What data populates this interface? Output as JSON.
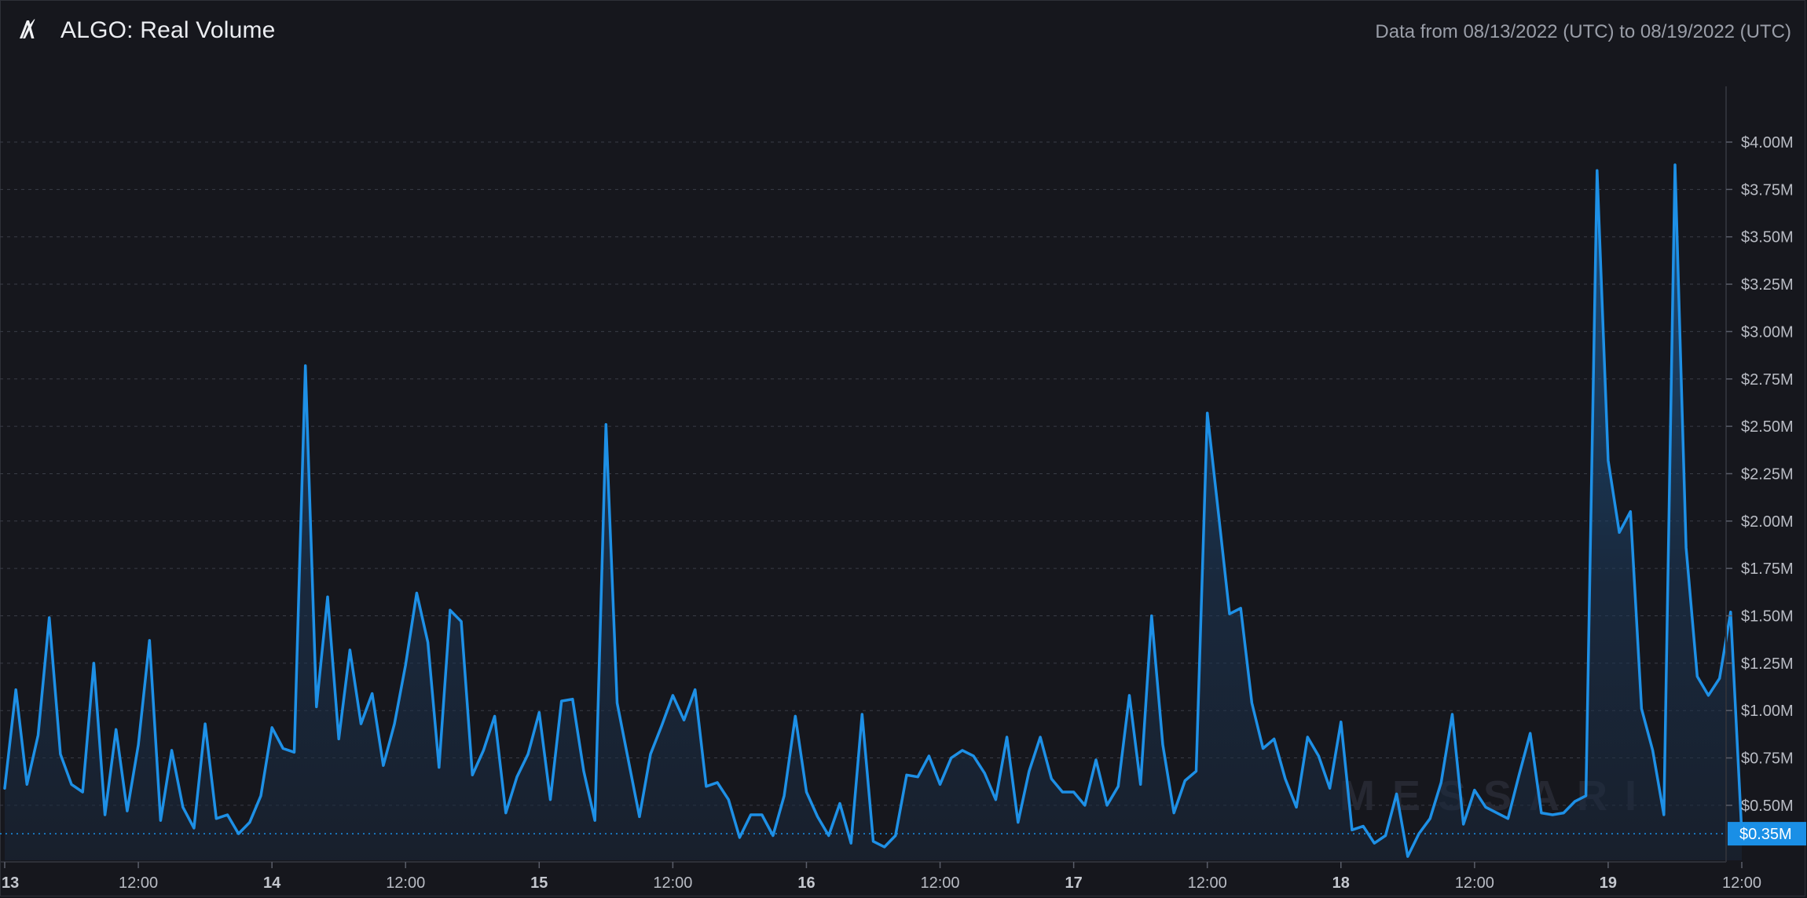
{
  "header": {
    "title": "ALGO: Real Volume",
    "date_range": "Data from 08/13/2022 (UTC) to 08/19/2022 (UTC)",
    "logo_icon": "algorand-logo-icon"
  },
  "watermark": "MESSARI",
  "colors": {
    "background": "#16171d",
    "line": "#1e90e6",
    "grid": "#3a3d47",
    "last_value_badge": "#1a8fe6"
  },
  "chart_data": {
    "type": "area",
    "title": "ALGO: Real Volume",
    "xlabel": "",
    "ylabel": "",
    "grid": true,
    "unit": "USD millions",
    "ylim": [
      0.1,
      4.4
    ],
    "x_start": "08/13/2022 00:00 (UTC)",
    "interval_hours": 1,
    "x_ticks": [
      {
        "hour": 0,
        "label": "13"
      },
      {
        "hour": 12,
        "label": "12:00"
      },
      {
        "hour": 24,
        "label": "14"
      },
      {
        "hour": 36,
        "label": "12:00"
      },
      {
        "hour": 48,
        "label": "15"
      },
      {
        "hour": 60,
        "label": "12:00"
      },
      {
        "hour": 72,
        "label": "16"
      },
      {
        "hour": 84,
        "label": "12:00"
      },
      {
        "hour": 96,
        "label": "17"
      },
      {
        "hour": 108,
        "label": "12:00"
      },
      {
        "hour": 120,
        "label": "18"
      },
      {
        "hour": 132,
        "label": "12:00"
      },
      {
        "hour": 144,
        "label": "19"
      },
      {
        "hour": 156,
        "label": "12:00"
      }
    ],
    "y_ticks": [
      {
        "value": 0.5,
        "label": "$0.50M"
      },
      {
        "value": 0.75,
        "label": "$0.75M"
      },
      {
        "value": 1.0,
        "label": "$1.00M"
      },
      {
        "value": 1.25,
        "label": "$1.25M"
      },
      {
        "value": 1.5,
        "label": "$1.50M"
      },
      {
        "value": 1.75,
        "label": "$1.75M"
      },
      {
        "value": 2.0,
        "label": "$2.00M"
      },
      {
        "value": 2.25,
        "label": "$2.25M"
      },
      {
        "value": 2.5,
        "label": "$2.50M"
      },
      {
        "value": 2.75,
        "label": "$2.75M"
      },
      {
        "value": 3.0,
        "label": "$3.00M"
      },
      {
        "value": 3.25,
        "label": "$3.25M"
      },
      {
        "value": 3.5,
        "label": "$3.50M"
      },
      {
        "value": 3.75,
        "label": "$3.75M"
      },
      {
        "value": 4.0,
        "label": "$4.00M"
      }
    ],
    "last_value": {
      "value": 0.35,
      "label": "$0.35M"
    },
    "series": [
      {
        "values": [
          0.59,
          1.11,
          0.61,
          0.87,
          1.49,
          0.77,
          0.61,
          0.57,
          1.25,
          0.45,
          0.9,
          0.47,
          0.82,
          1.37,
          0.42,
          0.79,
          0.49,
          0.38,
          0.93,
          0.43,
          0.45,
          0.35,
          0.41,
          0.55,
          0.91,
          0.8,
          0.78,
          2.82,
          1.02,
          1.6,
          0.85,
          1.32,
          0.93,
          1.09,
          0.71,
          0.93,
          1.24,
          1.62,
          1.36,
          0.7,
          1.53,
          1.47,
          0.66,
          0.79,
          0.97,
          0.46,
          0.65,
          0.77,
          0.99,
          0.53,
          1.05,
          1.06,
          0.68,
          0.42,
          2.51,
          1.04,
          0.74,
          0.44,
          0.77,
          0.92,
          1.08,
          0.95,
          1.11,
          0.6,
          0.62,
          0.53,
          0.33,
          0.45,
          0.45,
          0.34,
          0.55,
          0.97,
          0.57,
          0.44,
          0.34,
          0.51,
          0.3,
          0.98,
          0.31,
          0.28,
          0.34,
          0.66,
          0.65,
          0.76,
          0.61,
          0.75,
          0.79,
          0.76,
          0.67,
          0.53,
          0.86,
          0.41,
          0.68,
          0.86,
          0.64,
          0.57,
          0.57,
          0.5,
          0.74,
          0.5,
          0.6,
          1.08,
          0.61,
          1.5,
          0.82,
          0.46,
          0.63,
          0.68,
          2.57,
          2.04,
          1.51,
          1.54,
          1.04,
          0.8,
          0.85,
          0.64,
          0.49,
          0.86,
          0.76,
          0.59,
          0.94,
          0.37,
          0.39,
          0.3,
          0.34,
          0.56,
          0.23,
          0.35,
          0.43,
          0.62,
          0.98,
          0.4,
          0.58,
          0.49,
          0.46,
          0.43,
          0.66,
          0.88,
          0.46,
          0.45,
          0.46,
          0.52,
          0.55,
          3.85,
          2.32,
          1.94,
          2.05,
          1.01,
          0.79,
          0.45,
          3.88,
          1.86,
          1.18,
          1.08,
          1.17,
          1.52,
          0.35
        ]
      }
    ]
  }
}
